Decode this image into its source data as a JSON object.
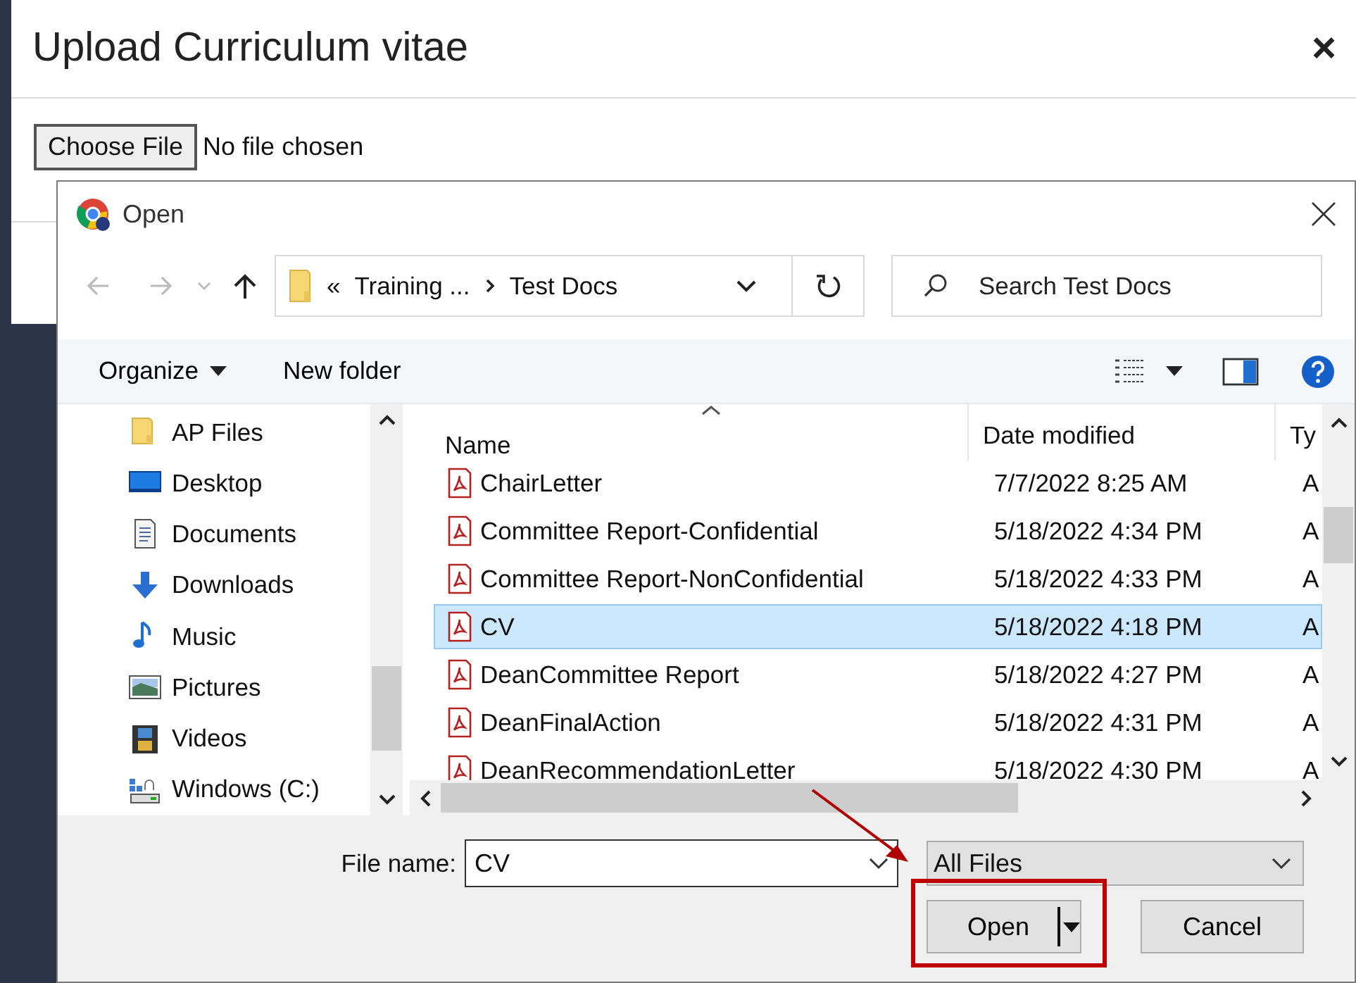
{
  "modal": {
    "title": "Upload Curriculum vitae",
    "close": "×",
    "choose_button": "Choose File",
    "file_status": "No file chosen"
  },
  "dialog": {
    "title": "Open",
    "path_overflow": "«",
    "breadcrumb": [
      "Training ...",
      "Test Docs"
    ],
    "search_placeholder": "Search Test Docs",
    "organize": "Organize",
    "new_folder": "New folder",
    "nav_items": [
      {
        "label": "AP Files",
        "kind": "folder"
      },
      {
        "label": "Desktop",
        "kind": "desktop"
      },
      {
        "label": "Documents",
        "kind": "documents"
      },
      {
        "label": "Downloads",
        "kind": "downloads"
      },
      {
        "label": "Music",
        "kind": "music"
      },
      {
        "label": "Pictures",
        "kind": "pictures"
      },
      {
        "label": "Videos",
        "kind": "videos"
      },
      {
        "label": "Windows (C:)",
        "kind": "drive"
      }
    ],
    "columns": [
      "Name",
      "Date modified",
      "Ty"
    ],
    "files": [
      {
        "name": "ChairLetter",
        "date": "7/7/2022 8:25 AM",
        "type": "A",
        "selected": false
      },
      {
        "name": "Committee Report-Confidential",
        "date": "5/18/2022 4:34 PM",
        "type": "A",
        "selected": false
      },
      {
        "name": "Committee Report-NonConfidential",
        "date": "5/18/2022 4:33 PM",
        "type": "A",
        "selected": false
      },
      {
        "name": "CV",
        "date": "5/18/2022 4:18 PM",
        "type": "A",
        "selected": true
      },
      {
        "name": "DeanCommittee Report",
        "date": "5/18/2022 4:27 PM",
        "type": "A",
        "selected": false
      },
      {
        "name": "DeanFinalAction",
        "date": "5/18/2022 4:31 PM",
        "type": "A",
        "selected": false
      },
      {
        "name": "DeanRecommendationLetter",
        "date": "5/18/2022 4:30 PM",
        "type": "A",
        "selected": false
      }
    ],
    "file_name_label": "File name:",
    "file_name": "CV",
    "filter": "All Files",
    "open_button": "Open",
    "cancel_button": "Cancel"
  }
}
